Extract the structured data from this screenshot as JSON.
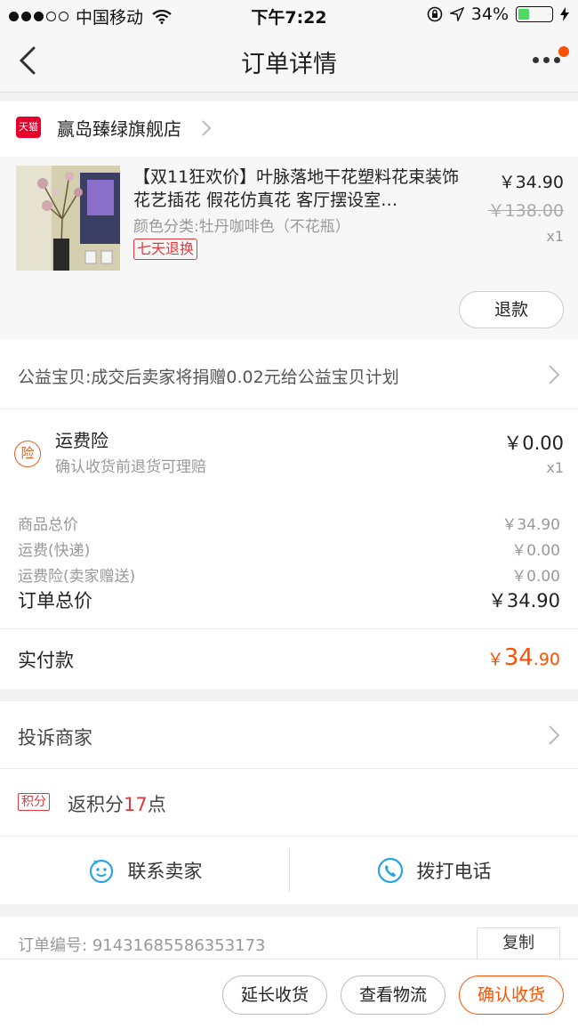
{
  "status_bar": {
    "carrier": "中国移动",
    "time": "下午7:22",
    "battery": "34%",
    "battery_level": 0.34
  },
  "nav": {
    "title": "订单详情",
    "back_icon": "chevron-left-icon",
    "more_icon": "more-dots-icon"
  },
  "shop": {
    "badge": "天猫",
    "name": "赢岛臻绿旗舰店"
  },
  "product": {
    "title": "【双11狂欢价】叶脉落地干花塑料花束装饰花艺插花 假花仿真花 客厅摆设室…",
    "sku": "颜色分类:牡丹咖啡色（不花瓶）",
    "badge": "七天退换",
    "price": "￥34.90",
    "original_price": "￥138.00",
    "quantity": "x1",
    "refund_button": "退款"
  },
  "charity": {
    "text": "公益宝贝:成交后卖家将捐赠0.02元给公益宝贝计划"
  },
  "shipping_insurance": {
    "icon_text": "险",
    "title": "运费险",
    "subtitle": "确认收货前退货可理赔",
    "price": "￥0.00",
    "quantity": "x1"
  },
  "summary": {
    "rows": [
      {
        "label": "商品总价",
        "value": "￥34.90"
      },
      {
        "label": "运费(快递)",
        "value": "￥0.00"
      },
      {
        "label": "运费险(卖家赠送)",
        "value": "￥0.00"
      }
    ],
    "total_label": "订单总价",
    "total_value": "￥34.90"
  },
  "paid": {
    "label": "实付款",
    "currency": "￥",
    "amount_int": "34",
    "amount_dec": ".90"
  },
  "complain": {
    "text": "投诉商家"
  },
  "points": {
    "badge": "积分",
    "prefix": "返积分",
    "number": "17",
    "suffix": "点"
  },
  "contact": {
    "seller_label": "联系卖家",
    "phone_label": "拨打电话"
  },
  "order": {
    "number_label": "订单编号:",
    "number": "91431685586353173",
    "copy_button": "复制"
  },
  "bottom_actions": {
    "extend": "延长收货",
    "logistics": "查看物流",
    "confirm": "确认收货"
  },
  "colors": {
    "accent": "#ff5000",
    "tmall_red": "#e4002b",
    "badge_red": "#e4393c",
    "contact_blue": "#2aa4e6",
    "battery_green": "#4cd964"
  }
}
